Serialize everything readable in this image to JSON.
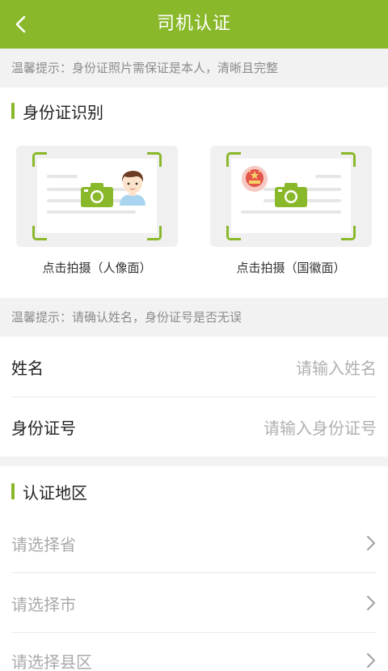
{
  "header": {
    "title": "司机认证",
    "back_icon": "chevron-left-icon"
  },
  "tips": {
    "photo": "温馨提示：身份证照片需保证是本人，清晰且完整",
    "info": "温馨提示：请确认姓名，身份证号是否无误"
  },
  "id_section": {
    "title": "身份证识别",
    "front_label": "点击拍摄（人像面）",
    "back_label": "点击拍摄（国徽面）"
  },
  "form": {
    "name_label": "姓名",
    "name_placeholder": "请输入姓名",
    "id_label": "身份证号",
    "id_placeholder": "请输入身份证号"
  },
  "region": {
    "title": "认证地区",
    "province": "请选择省",
    "city": "请选择市",
    "district": "请选择县区"
  },
  "colors": {
    "accent": "#8ab82b",
    "background": "#f2f2f2",
    "placeholder": "#b0b0b0"
  }
}
